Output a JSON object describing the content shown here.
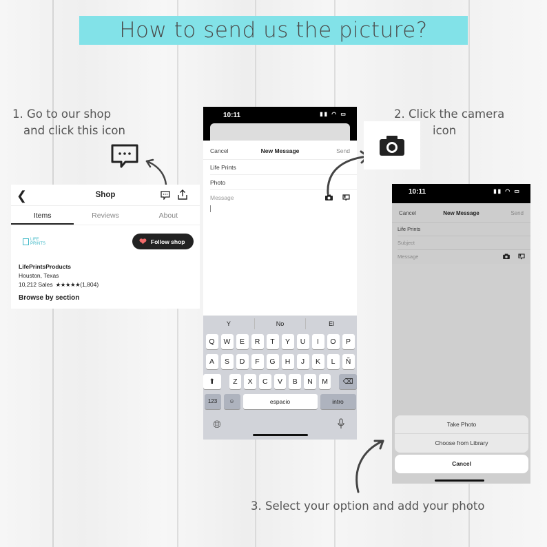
{
  "title": "How to send us the picture?",
  "steps": {
    "step1_line1": "1.   Go to our shop",
    "step1_line2": "and click this icon",
    "step2_line1": "2. Click the camera",
    "step2_line2": "icon",
    "step3": "3. Select your option and add your photo"
  },
  "colors": {
    "banner": "#82e2e8",
    "follow_heart": "#f26b6b",
    "logo_accent": "#3fb8c7"
  },
  "shop": {
    "header_title": "Shop",
    "back_icon": "chevron-left-icon",
    "message_icon": "chat-bubble-icon",
    "share_icon": "share-icon",
    "tabs": [
      {
        "label": "Items",
        "active": true
      },
      {
        "label": "Reviews",
        "active": false
      },
      {
        "label": "About",
        "active": false
      }
    ],
    "logo_text_1": "LIFE",
    "logo_text_2": "PRINTS",
    "follow_label": "Follow shop",
    "shop_name": "LifePrintsProducts",
    "location": "Houston, Texas",
    "sales": "10,212 Sales",
    "stars": "★★★★★",
    "review_count": "(1,804)",
    "rating": 5,
    "browse_label": "Browse by section"
  },
  "phone1": {
    "time": "10:11",
    "status_icons": "signal wifi battery",
    "nav": {
      "cancel": "Cancel",
      "title": "New Message",
      "send": "Send"
    },
    "fields": {
      "to": "Life Prints",
      "subject": "Photo",
      "message_placeholder": "Message"
    },
    "keyboard": {
      "suggestions": [
        "Y",
        "No",
        "El"
      ],
      "row1": [
        "Q",
        "W",
        "E",
        "R",
        "T",
        "Y",
        "U",
        "I",
        "O",
        "P"
      ],
      "row2": [
        "A",
        "S",
        "D",
        "F",
        "G",
        "H",
        "J",
        "K",
        "L",
        "Ñ"
      ],
      "row3": [
        "Z",
        "X",
        "C",
        "V",
        "B",
        "N",
        "M"
      ],
      "numbers_label": "123",
      "space_label": "espacio",
      "return_label": "intro"
    }
  },
  "phone2": {
    "time": "10:11",
    "nav": {
      "cancel": "Cancel",
      "title": "New Message",
      "send": "Send"
    },
    "fields": {
      "to": "Life Prints",
      "subject_placeholder": "Subject",
      "message_placeholder": "Message"
    },
    "actions": [
      "Take Photo",
      "Choose from Library"
    ],
    "cancel_action": "Cancel"
  }
}
